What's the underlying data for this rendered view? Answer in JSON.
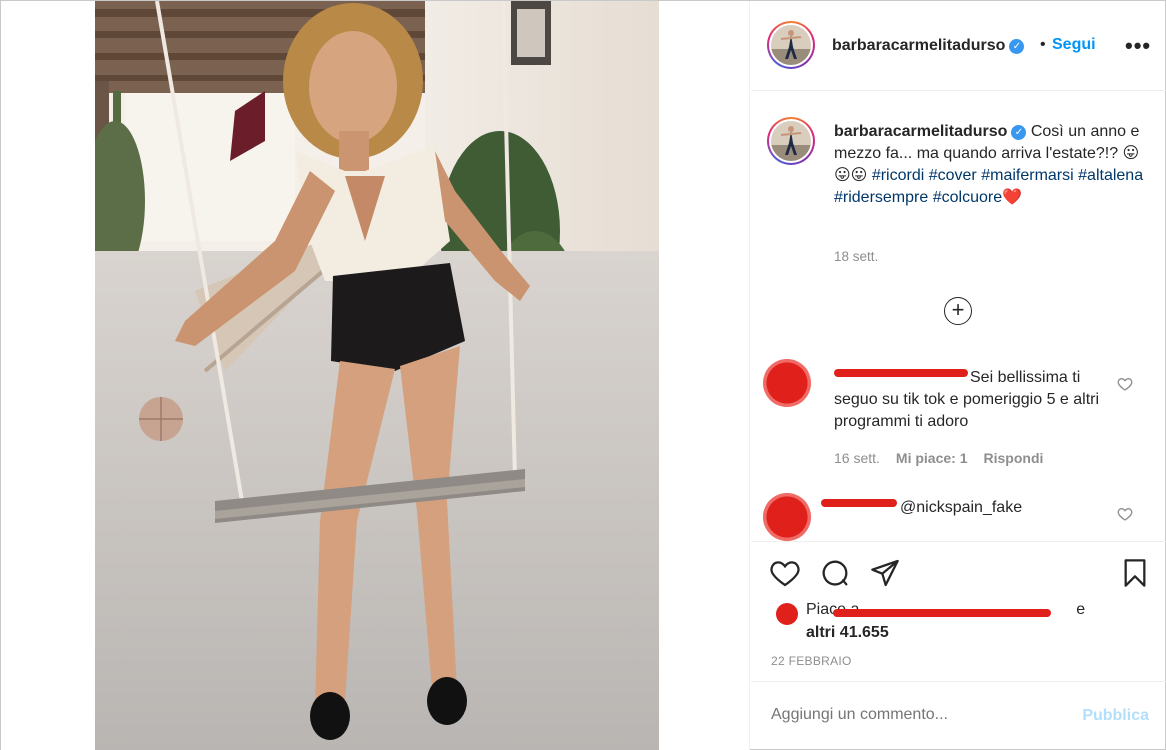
{
  "post": {
    "username": "barbaracarmelitadurso",
    "verified_glyph": "✓",
    "dot": "•",
    "follow_label": "Segui",
    "more_label": "•••"
  },
  "caption": {
    "username": "barbaracarmelitadurso",
    "text_a": " Così un anno e mezzo fa... ma quando arriva l'estate?!? 😛😛😛 ",
    "hashtags": [
      "#ricordi",
      "#cover",
      "#maifermarsi",
      "#altalena",
      "#ridersempre",
      "#colcuore"
    ],
    "heart": "❤️",
    "time": "18 sett."
  },
  "load_more_label": "+",
  "comments": [
    {
      "text": " Sei bellissima ti seguo su tik tok e pomeriggio 5 e altri programmi ti adoro",
      "time": "16 sett.",
      "likes": "Mi piace: 1",
      "reply": "Rispondi"
    },
    {
      "mention": "@nickspain_fake"
    }
  ],
  "likes": {
    "prefix": "Piace a ",
    "suffix": " e",
    "count": "altri 41.655"
  },
  "date": "22 FEBBRAIO",
  "add_comment": {
    "placeholder": "Aggiungi un commento...",
    "publish_label": "Pubblica"
  },
  "colors": {
    "link": "#0095f6",
    "hashtag": "#00376b",
    "muted": "#8e8e8e",
    "redaction": "#e0201b"
  },
  "icons": [
    "heart-icon",
    "comment-icon",
    "share-icon",
    "bookmark-icon",
    "verified-badge-icon",
    "plus-circle-icon",
    "more-icon"
  ]
}
